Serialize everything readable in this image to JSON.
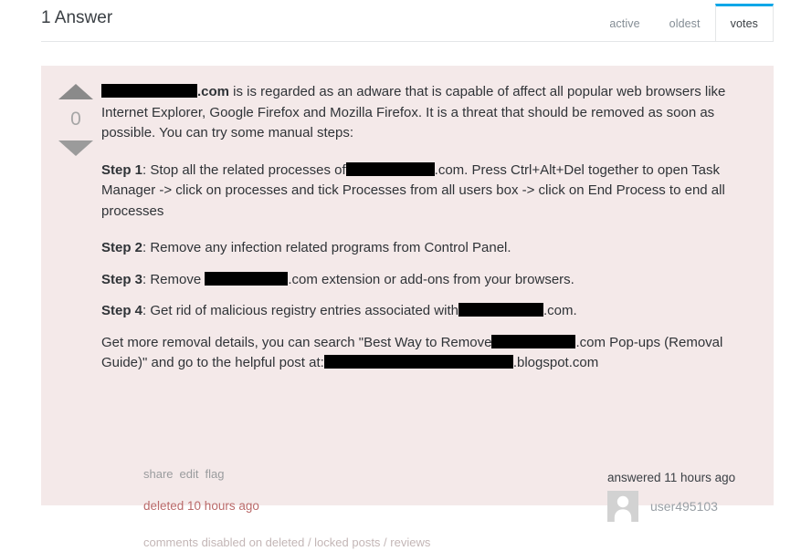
{
  "header": {
    "title": "1 Answer",
    "tabs": [
      {
        "label": "active",
        "active": false
      },
      {
        "label": "oldest",
        "active": false
      },
      {
        "label": "votes",
        "active": true
      }
    ],
    "accent_color": "#0aa7e8"
  },
  "answer": {
    "background_color": "#f4e9e9",
    "vote": {
      "up_label": "up-vote",
      "down_label": "down-vote",
      "count": "0"
    },
    "paragraphs": {
      "intro": {
        "redacted_1": "",
        "t1": ".com",
        "t2": " is is regarded as an adware that is capable of affect all popular web browsers like Internet Explorer, Google Firefox and Mozilla Firefox. It is a threat that should be removed as soon as possible. You can try some manual steps:"
      },
      "step1": {
        "label": "Step 1",
        "t1": ": Stop all the related processes of",
        "redacted_1": "",
        "t2": ".com. Press Ctrl+Alt+Del together to open Task Manager -> click on processes and tick Processes from all users box -> click on End Process to end all processes"
      },
      "step2": {
        "label": "Step 2",
        "t1": ": Remove any infection related programs from Control Panel."
      },
      "step3": {
        "label": "Step 3",
        "t1": ": Remove ",
        "redacted_1": "",
        "t2": ".com extension or add-ons from your browsers."
      },
      "step4": {
        "label": "Step 4",
        "t1": ": Get rid of malicious registry entries associated with",
        "redacted_1": "",
        "t2": ".com."
      },
      "outro": {
        "t1": "Get more removal details, you can search \"Best Way to Remove",
        "redacted_1": "",
        "t2": ".com Pop-ups (Removal Guide)\" and go to the helpful post at:",
        "redacted_2": "",
        "t3": ".blogspot.com"
      }
    },
    "menu": {
      "share": "share",
      "edit": "edit",
      "flag": "flag"
    },
    "deleted_note": "deleted 10 hours ago",
    "user_card": {
      "answered": "answered 11 hours ago",
      "user_name": "user495103"
    },
    "comments_note": "comments disabled on deleted / locked posts / reviews"
  }
}
